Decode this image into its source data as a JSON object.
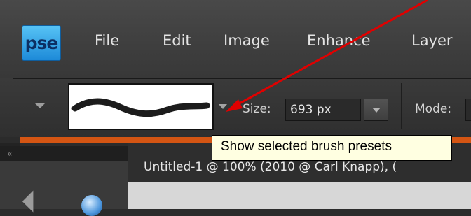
{
  "app": {
    "logo_text": "pse",
    "brand_color": "#2a9be6"
  },
  "menu": {
    "items": [
      "File",
      "Edit",
      "Image",
      "Enhance",
      "Layer"
    ]
  },
  "options_bar": {
    "size_label": "Size:",
    "size_value": "693 px",
    "mode_label": "Mode:"
  },
  "panel": {
    "collapse_icon": "«"
  },
  "document": {
    "tab_title": "Untitled-1 @ 100% (2010 @ Carl Knapp), ("
  },
  "tooltip": {
    "text": "Show selected brush presets"
  },
  "annotation": {
    "arrow_color": "#e00000",
    "accent_line_color": "#d45513"
  }
}
